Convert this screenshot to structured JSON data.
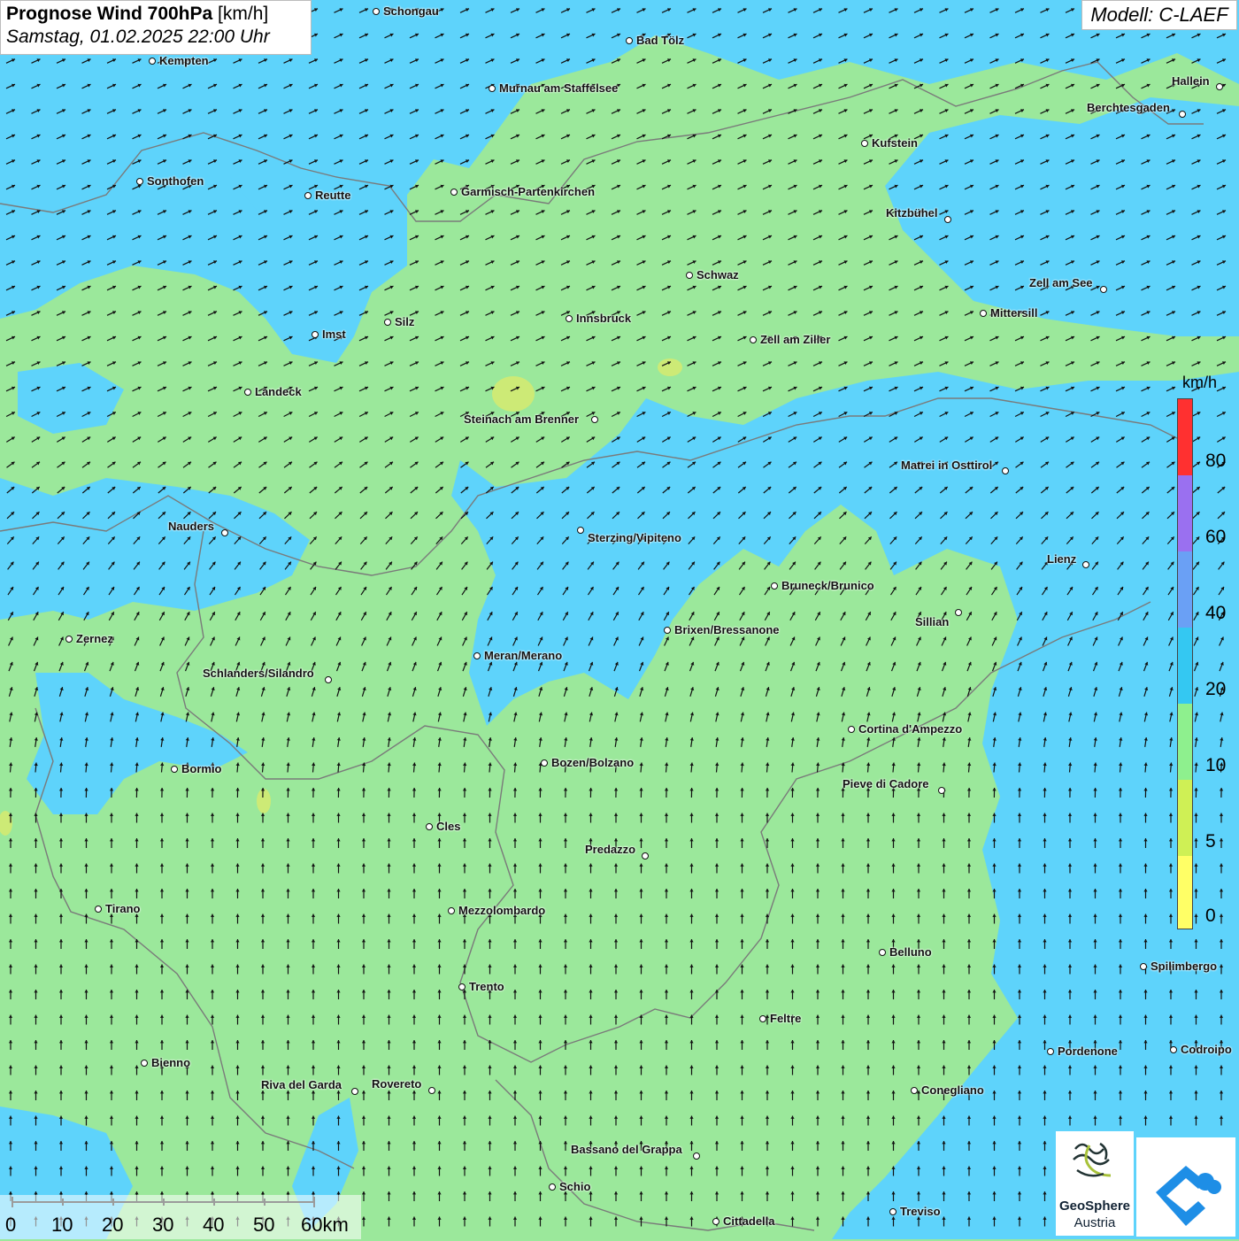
{
  "header": {
    "title_bold": "Prognose Wind 700hPa",
    "title_unit": "[km/h]",
    "subtitle": "Samstag, 01.02.2025 22:00 Uhr",
    "model": "Modell: C-LAEF"
  },
  "colors": {
    "land_low": "#9be89b",
    "wind_blue": "#5ed3fb",
    "yellow_patch": "#cdea76",
    "border": "#7a7a7a",
    "arrow": "#111111"
  },
  "legend": {
    "unit": "km/h",
    "bands": [
      {
        "color": "#ff3030"
      },
      {
        "color": "#9a70f0"
      },
      {
        "color": "#6aa0f5"
      },
      {
        "color": "#34c8f2"
      },
      {
        "color": "#8ef08e"
      },
      {
        "color": "#cff055"
      },
      {
        "color": "#ffff66"
      }
    ],
    "labels": [
      {
        "text": "80"
      },
      {
        "text": "60"
      },
      {
        "text": "40"
      },
      {
        "text": "20"
      },
      {
        "text": "10"
      },
      {
        "text": "5"
      },
      {
        "text": "0"
      }
    ]
  },
  "scale": {
    "labels": [
      {
        "text": "0"
      },
      {
        "text": "10"
      },
      {
        "text": "20"
      },
      {
        "text": "30"
      },
      {
        "text": "40"
      },
      {
        "text": "50"
      },
      {
        "text": "60km"
      }
    ]
  },
  "cities": [
    {
      "name": "Schongau"
    },
    {
      "name": "Bad Tölz"
    },
    {
      "name": "Kempten"
    },
    {
      "name": "Murnau am Staffelsee"
    },
    {
      "name": "Hallein"
    },
    {
      "name": "Berchtesgaden"
    },
    {
      "name": "Kufstein"
    },
    {
      "name": "Sonthofen"
    },
    {
      "name": "Reutte"
    },
    {
      "name": "Garmisch-Partenkirchen"
    },
    {
      "name": "Kitzbühel"
    },
    {
      "name": "Schwaz"
    },
    {
      "name": "Zell am See"
    },
    {
      "name": "Mittersill"
    },
    {
      "name": "Innsbruck"
    },
    {
      "name": "Silz"
    },
    {
      "name": "Imst"
    },
    {
      "name": "Zell am Ziller"
    },
    {
      "name": "Landeck"
    },
    {
      "name": "Steinach am Brenner"
    },
    {
      "name": "Matrei in Osttirol"
    },
    {
      "name": "Nauders"
    },
    {
      "name": "Sterzing/Vipiteno"
    },
    {
      "name": "Lienz"
    },
    {
      "name": "Bruneck/Brunico"
    },
    {
      "name": "Sillian"
    },
    {
      "name": "Brixen/Bressanone"
    },
    {
      "name": "Zernez"
    },
    {
      "name": "Meran/Merano"
    },
    {
      "name": "Schlanders/Silandro"
    },
    {
      "name": "Cortina d'Ampezzo"
    },
    {
      "name": "Bozen/Bolzano"
    },
    {
      "name": "Bormio"
    },
    {
      "name": "Pieve di Cadore"
    },
    {
      "name": "Cles"
    },
    {
      "name": "Predazzo"
    },
    {
      "name": "Tirano"
    },
    {
      "name": "Mezzolombardo"
    },
    {
      "name": "Belluno"
    },
    {
      "name": "Spilimbergo"
    },
    {
      "name": "Trento"
    },
    {
      "name": "Feltre"
    },
    {
      "name": "Pordenone"
    },
    {
      "name": "Codroipo"
    },
    {
      "name": "Bienno"
    },
    {
      "name": "Riva del Garda"
    },
    {
      "name": "Rovereto"
    },
    {
      "name": "Conegliano"
    },
    {
      "name": "Bassano del Grappa"
    },
    {
      "name": "Schio"
    },
    {
      "name": "Treviso"
    },
    {
      "name": "Cittadella"
    }
  ],
  "logo": {
    "line1": "GeoSphere",
    "line2": "Austria"
  }
}
